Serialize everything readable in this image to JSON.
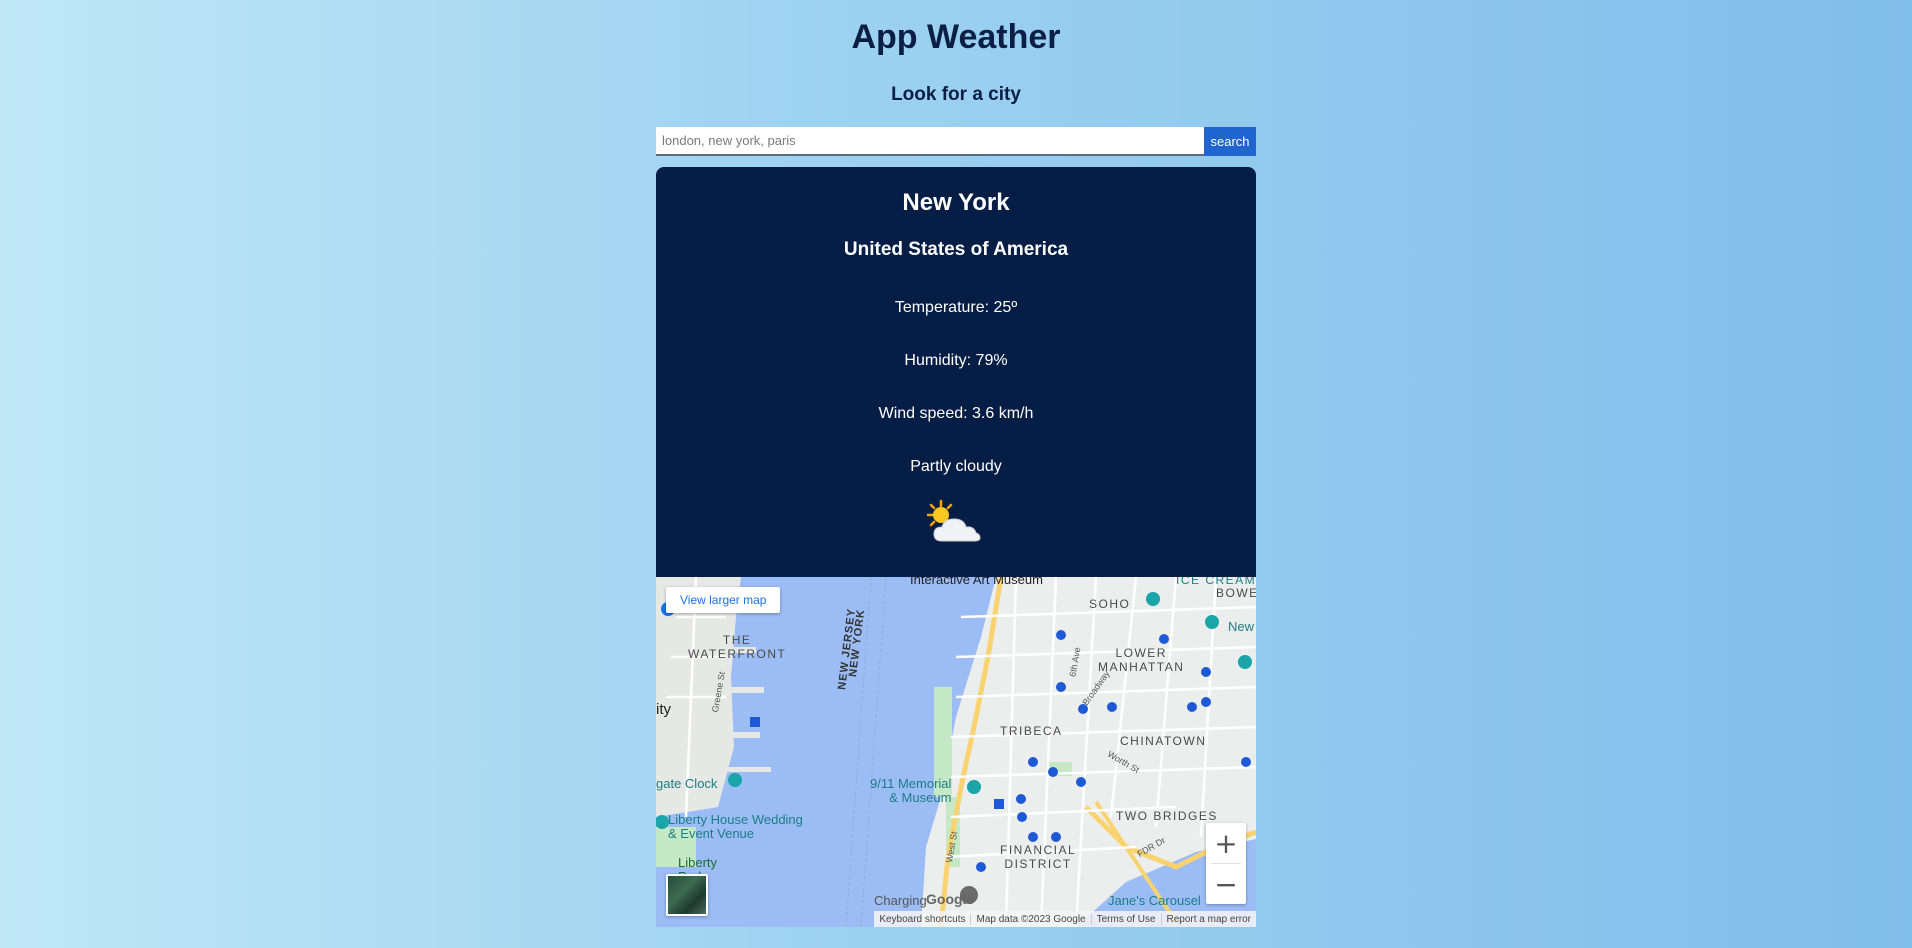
{
  "app": {
    "title": "App Weather",
    "subtitle": "Look for a city"
  },
  "search": {
    "placeholder": "london, new york, paris",
    "value": "",
    "button_label": "search"
  },
  "weather": {
    "city": "New York",
    "country": "United States of America",
    "temperature": "Temperature: 25º",
    "humidity": "Humidity: 79%",
    "wind": "Wind speed: 3.6 km/h",
    "condition": "Partly cloudy",
    "icon": "partly-cloudy-icon"
  },
  "map": {
    "larger_map_link": "View larger map",
    "labels": {
      "interactive_art_museum": "Interactive Art Museum",
      "ice_cream": "ICE CREAM",
      "soho": "SOHO",
      "bowe": "BOWE",
      "new": "New",
      "the_waterfront": "THE\nWATERFRONT",
      "lower_manhattan": "LOWER\nMANHATTAN",
      "new_jersey": "NEW JERSEY",
      "new_york": "NEW YORK",
      "ity": "ity",
      "greene_st": "Greene St",
      "sixth_ave": "6th Ave",
      "broadway": "Broadway",
      "tribeca": "TRIBECA",
      "chinatown": "CHINATOWN",
      "gate_clock": "gate Clock",
      "worth_st": "Worth St",
      "memorial": "9/11 Memorial\n& Museum",
      "liberty_house": "Liberty House Wedding\n& Event Venue",
      "two_bridges": "TWO BRIDGES",
      "west_st": "West St",
      "financial_district": "FINANCIAL\nDISTRICT",
      "fdr_dr": "FDR Dr",
      "liberty_park": "Liberty\nPark",
      "charging": "Charging",
      "janes_carousel": "Jane's Carousel"
    },
    "logo_text": "Google",
    "zoom_in": "+",
    "zoom_out": "−",
    "attribution": {
      "shortcuts": "Keyboard shortcuts",
      "data": "Map data ©2023 Google",
      "terms": "Terms of Use",
      "report": "Report a map error"
    }
  },
  "colors": {
    "card_background": "#061e45",
    "search_button": "#1f64cf",
    "water": "#9cbcf6",
    "title_text": "#0b1f45"
  }
}
